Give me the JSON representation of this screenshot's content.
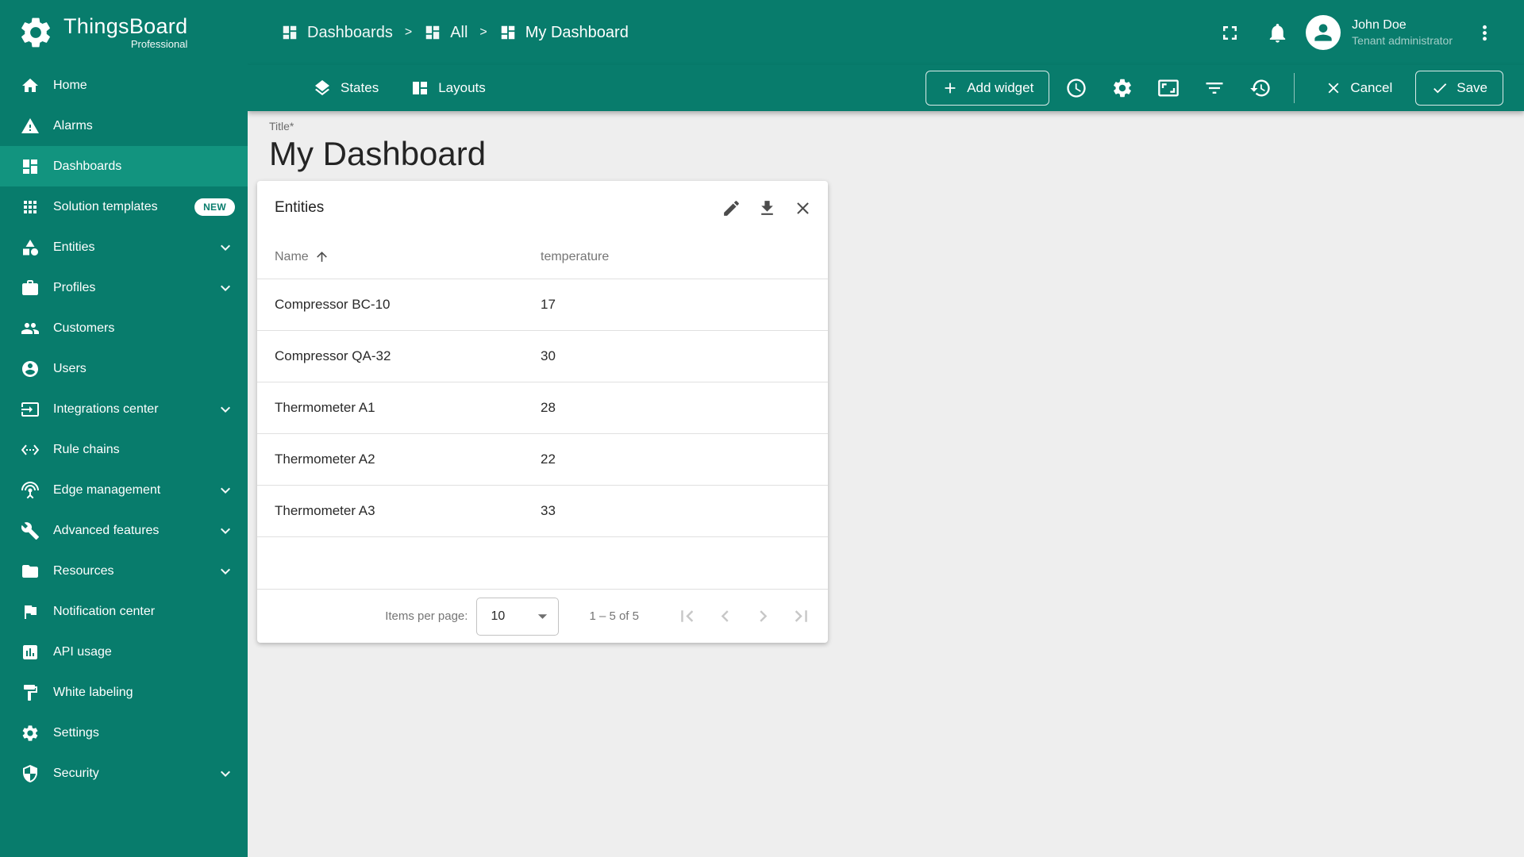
{
  "colors": {
    "primary": "#087c6c",
    "primary_active": "#12947f",
    "page_bg": "#eeeeee",
    "card_bg": "#ffffff",
    "text_primary": "#2a2a2a",
    "text_secondary": "#757575",
    "divider": "#e0e0e0",
    "disabled_icon": "#c7c7c7"
  },
  "sidebar": {
    "logo_title": "ThingsBoard",
    "logo_subtitle": "Professional",
    "items": [
      {
        "label": "Home",
        "icon": "home-icon"
      },
      {
        "label": "Alarms",
        "icon": "warning-icon"
      },
      {
        "label": "Dashboards",
        "icon": "dashboards-icon",
        "active": true
      },
      {
        "label": "Solution templates",
        "icon": "apps-icon",
        "badge": "NEW"
      },
      {
        "label": "Entities",
        "icon": "entities-icon",
        "expandable": true
      },
      {
        "label": "Profiles",
        "icon": "profiles-icon",
        "expandable": true
      },
      {
        "label": "Customers",
        "icon": "customers-icon"
      },
      {
        "label": "Users",
        "icon": "users-icon"
      },
      {
        "label": "Integrations center",
        "icon": "integrations-icon",
        "expandable": true
      },
      {
        "label": "Rule chains",
        "icon": "rule-chains-icon"
      },
      {
        "label": "Edge management",
        "icon": "edge-management-icon",
        "expandable": true
      },
      {
        "label": "Advanced features",
        "icon": "advanced-features-icon",
        "expandable": true
      },
      {
        "label": "Resources",
        "icon": "resources-icon",
        "expandable": true
      },
      {
        "label": "Notification center",
        "icon": "notification-center-icon"
      },
      {
        "label": "API usage",
        "icon": "api-usage-icon"
      },
      {
        "label": "White labeling",
        "icon": "white-labeling-icon"
      },
      {
        "label": "Settings",
        "icon": "settings-icon"
      },
      {
        "label": "Security",
        "icon": "security-icon",
        "expandable": true
      }
    ]
  },
  "header": {
    "breadcrumb": [
      {
        "label": "Dashboards",
        "icon": "dashboards-icon"
      },
      {
        "label": "All",
        "icon": "dashboards-icon"
      },
      {
        "label": "My Dashboard",
        "icon": "dashboards-icon"
      }
    ],
    "separator": ">",
    "actions": [
      {
        "icon": "fullscreen-icon"
      },
      {
        "icon": "notifications-icon"
      }
    ],
    "user_name": "John Doe",
    "user_role": "Tenant administrator",
    "more_icon": "more-vert-icon"
  },
  "toolbar": {
    "states": "States",
    "layouts": "Layouts",
    "add_widget": "Add widget",
    "right_icons": [
      "time-window-icon",
      "dashboard-settings-icon",
      "manage-layouts-icon",
      "filter-icon",
      "version-history-icon"
    ],
    "cancel": "Cancel",
    "save": "Save"
  },
  "dashboard": {
    "title_label": "Title*",
    "title": "My Dashboard"
  },
  "widget": {
    "title": "Entities",
    "actions": [
      "edit-icon",
      "download-icon",
      "close-icon"
    ],
    "columns": {
      "name": "Name",
      "temperature": "temperature",
      "sorted_by": "Name",
      "sort_direction": "asc"
    },
    "rows": [
      {
        "name": "Compressor BC-10",
        "temperature": "17"
      },
      {
        "name": "Compressor QA-32",
        "temperature": "30"
      },
      {
        "name": "Thermometer A1",
        "temperature": "28"
      },
      {
        "name": "Thermometer A2",
        "temperature": "22"
      },
      {
        "name": "Thermometer A3",
        "temperature": "33"
      }
    ],
    "pagination": {
      "items_per_page_label": "Items per page:",
      "page_size": "10",
      "range": "1 – 5 of 5",
      "nav_icons": [
        "first-page-icon",
        "previous-page-icon",
        "next-page-icon",
        "last-page-icon"
      ]
    }
  }
}
